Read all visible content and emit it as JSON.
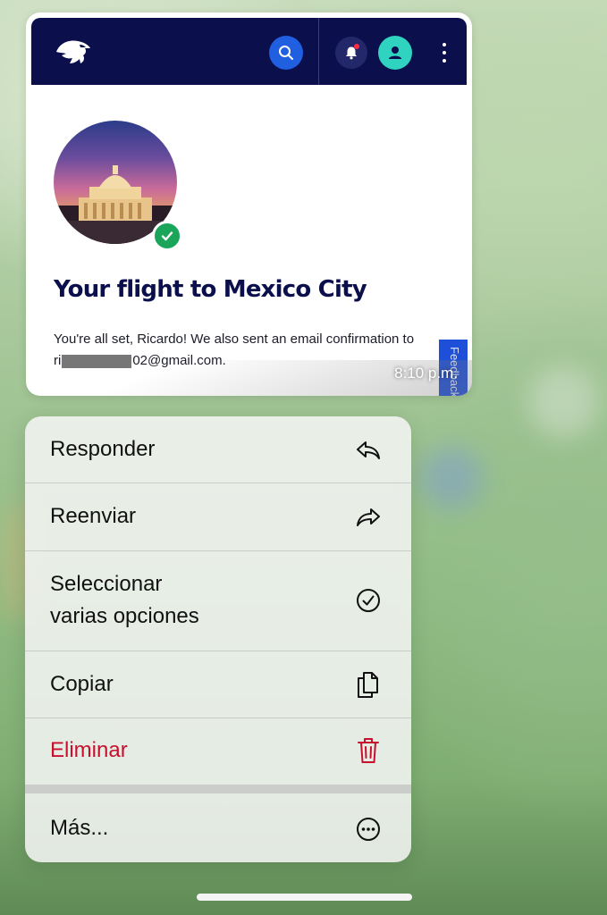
{
  "preview": {
    "title": "Your flight to Mexico City",
    "body_line1": "You're all set, Ricardo! We also sent an email confirmation to",
    "email_prefix": "ri",
    "email_suffix": "02@gmail.com.",
    "time": "8:10 p.m.",
    "feedback_tab": "Feedback",
    "header_icons": [
      "eagle-logo-icon",
      "search-icon",
      "bell-icon",
      "user-icon",
      "more-vertical-icon"
    ]
  },
  "menu": {
    "items": [
      {
        "label": "Responder",
        "icon": "reply-icon"
      },
      {
        "label": "Reenviar",
        "icon": "forward-icon"
      },
      {
        "label_line1": "Seleccionar",
        "label_line2": "varias opciones",
        "icon": "check-circle-icon"
      },
      {
        "label": "Copiar",
        "icon": "copy-icon"
      },
      {
        "label": "Eliminar",
        "icon": "trash-icon",
        "color": "#c8102e"
      },
      {
        "label": "Más...",
        "icon": "more-circle-icon"
      }
    ]
  },
  "colors": {
    "header_navy": "#0b0f4c",
    "search_blue": "#1f5fe0",
    "avatar_teal": "#2fd3bf",
    "success_green": "#1aa55a",
    "destructive_red": "#c8102e"
  }
}
